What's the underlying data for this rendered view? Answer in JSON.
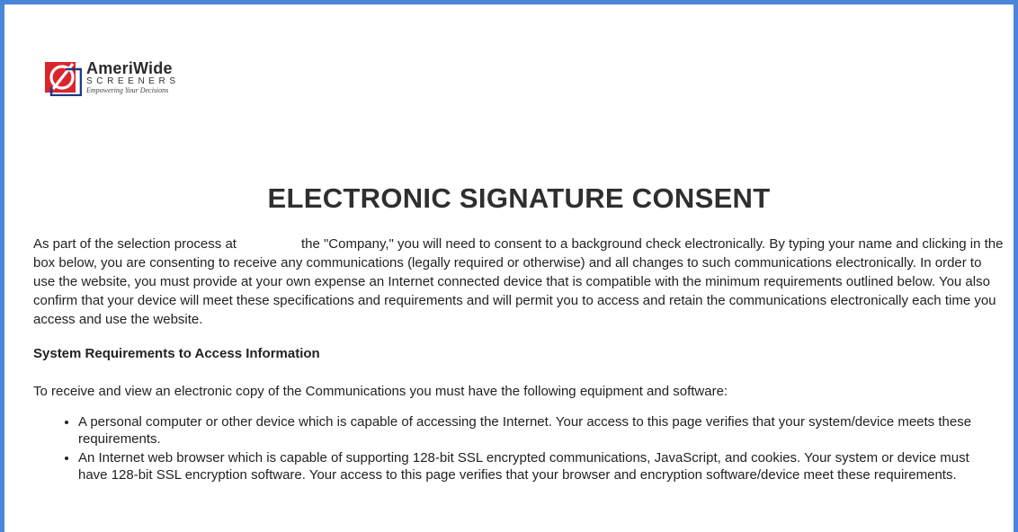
{
  "brand": {
    "name": "AmeriWide",
    "sub": "SCREENERS",
    "tagline": "Empowering Your Decisions",
    "colors": {
      "mark_red": "#d9262c",
      "mark_blue": "#1f3a8a",
      "frame_blue": "#4a86d8"
    }
  },
  "page": {
    "title": "ELECTRONIC SIGNATURE CONSENT",
    "intro_before": "As part of the selection process at",
    "intro_after": "the \"Company,\" you will need to consent to a background check electronically. By typing your name and clicking in the box below, you are consenting to receive any communications (legally required or otherwise) and all changes to such communications electronically. In order to use the website, you must provide at your own expense an Internet connected device that is compatible with the minimum requirements outlined below. You also confirm that your device will meet these specifications and requirements and will permit you to access and retain the communications electronically each time you access and use the website.",
    "section_heading": "System Requirements to Access Information",
    "lead": "To receive and view an electronic copy of the Communications you must have the following equipment and software:",
    "requirements": [
      "A personal computer or other device which is capable of accessing the Internet. Your access to this page verifies that your system/device meets these requirements.",
      "An Internet web browser which is capable of supporting 128-bit SSL encrypted communications, JavaScript, and cookies. Your system or device must have 128-bit SSL encryption software. Your access to this page verifies that your browser and encryption software/device meet these requirements."
    ]
  }
}
